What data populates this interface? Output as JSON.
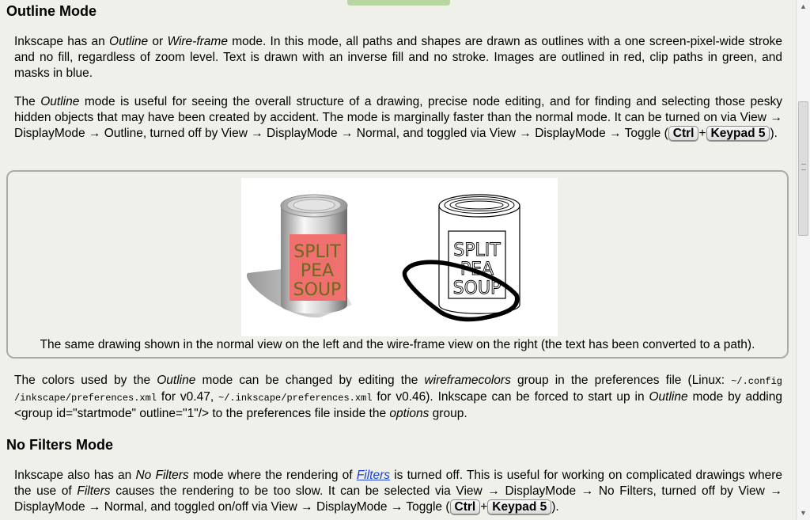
{
  "outline_section": {
    "heading": "Outline Mode",
    "p1": [
      {
        "t": "Inkscape has an "
      },
      {
        "t": "Outline",
        "i": true
      },
      {
        "t": " or "
      },
      {
        "t": "Wire-frame",
        "i": true
      },
      {
        "t": " mode. In this mode, all paths and shapes are drawn as outlines with a one screen-pixel-wide stroke and no fill, regardless of zoom level. Text is drawn with an inverse fill and no stroke. Images are outlined in red, clip paths in green, and masks in blue."
      }
    ],
    "p2": [
      {
        "t": "The "
      },
      {
        "t": "Outline",
        "i": true
      },
      {
        "t": " mode is useful for seeing the overall structure of a drawing, precise node editing, and for finding and selecting those pesky hidden objects that may have been created by accident. The mode is marginally faster than the normal mode. It can be turned on via View → DisplayMode → Outline, turned off by View → DisplayMode → Normal, and toggled via View → DisplayMode → Toggle ("
      },
      {
        "k": "Ctrl"
      },
      {
        "t": "+"
      },
      {
        "k": "Keypad 5"
      },
      {
        "t": ")."
      }
    ],
    "figure": {
      "left_label": [
        "SPLIT",
        "PEA",
        "SOUP"
      ],
      "right_label": [
        "SPLIT",
        "PEA",
        "SOUP"
      ],
      "caption": "The same drawing shown in the normal view on the left and the wire-frame view on the right (the text has been converted to a path)."
    },
    "p3": [
      {
        "t": "The colors used by the "
      },
      {
        "t": "Outline",
        "i": true
      },
      {
        "t": " mode can be changed by editing the "
      },
      {
        "t": "wireframecolors",
        "i": true
      },
      {
        "t": " group in the preferences file (Linux: "
      },
      {
        "m": "~/.config /inkscape/preferences.xml"
      },
      {
        "t": " for v0.47, "
      },
      {
        "m": "~/.inkscape/preferences.xml"
      },
      {
        "t": " for v0.46). Inkscape can be forced to start up in "
      },
      {
        "t": "Outline",
        "i": true
      },
      {
        "t": " mode by adding <group id=\"startmode\" outline=\"1\"/> to the preferences file inside the "
      },
      {
        "t": "options",
        "i": true
      },
      {
        "t": " group."
      }
    ]
  },
  "nofilters_section": {
    "heading": "No Filters Mode",
    "p1": [
      {
        "t": "Inkscape also has an "
      },
      {
        "t": "No Filters",
        "i": true
      },
      {
        "t": " mode where the rendering of "
      },
      {
        "a": "Filters"
      },
      {
        "t": " is turned off. This is useful for working on complicated drawings where the use of "
      },
      {
        "t": "Filters",
        "i": true
      },
      {
        "t": " causes the rendering to be too slow. It can be selected via View → DisplayMode → No Filters, turned off by View → DisplayMode → Normal, and toggled on/off via View → DisplayMode → Toggle ("
      },
      {
        "k": "Ctrl"
      },
      {
        "t": "+"
      },
      {
        "k": "Keypad 5"
      },
      {
        "t": ")."
      }
    ]
  },
  "colors": {
    "background": "#f0f0ea",
    "can_label_fill": "#f07070",
    "can_label_text": "#6b6b1a",
    "link": "#1a3fd1"
  }
}
